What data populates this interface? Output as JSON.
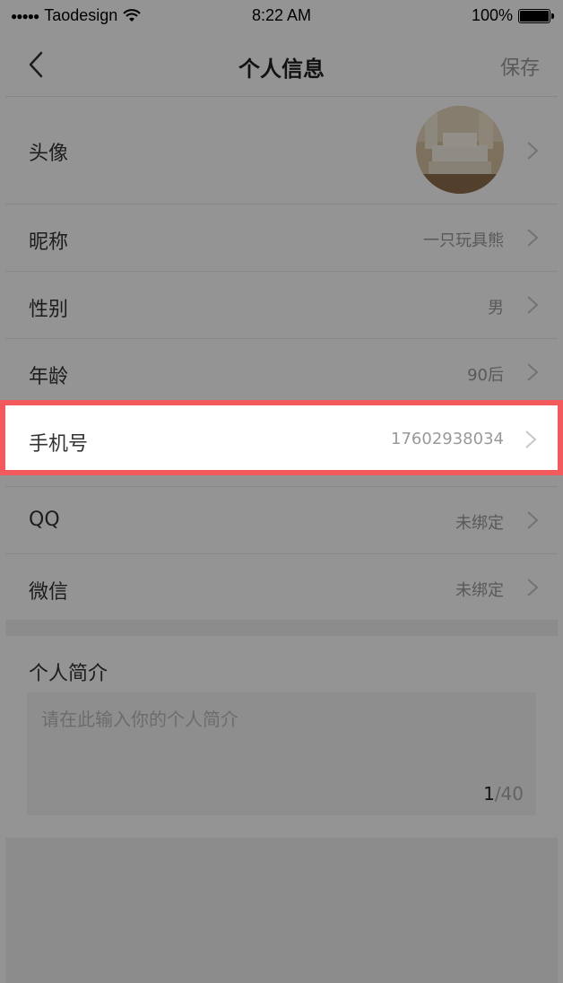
{
  "status_bar": {
    "signal": "●●●●●",
    "carrier": "Taodesign",
    "time": "8:22 AM",
    "battery_text": "100%",
    "battery_level": 1.0
  },
  "nav": {
    "title": "个人信息",
    "save_label": "保存",
    "back_icon": "chevron-left-icon"
  },
  "rows": {
    "avatar": {
      "label": "头像"
    },
    "nickname": {
      "label": "昵称",
      "value": "一只玩具熊"
    },
    "gender": {
      "label": "性别",
      "value": "男"
    },
    "age": {
      "label": "年龄",
      "value": "90后"
    },
    "phone": {
      "label": "手机号",
      "value": "17602938034"
    },
    "qq": {
      "label": "QQ",
      "value": "未绑定"
    },
    "wechat": {
      "label": "微信",
      "value": "未绑定"
    }
  },
  "bio": {
    "title": "个人简介",
    "placeholder": "请在此输入你的个人简介",
    "count_current": "1",
    "count_max": "/40"
  },
  "colors": {
    "highlight_border": "#f25a5e",
    "overlay": "rgba(0,0,0,0.42)"
  }
}
